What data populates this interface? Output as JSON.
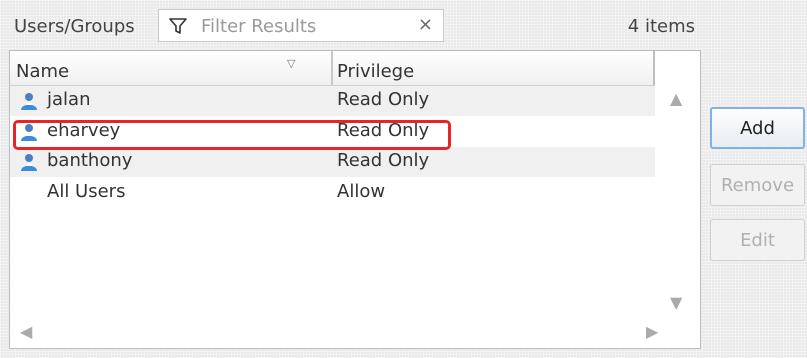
{
  "panel": {
    "title": "Users/Groups",
    "filter_placeholder": "Filter Results",
    "clear_label": "×",
    "item_count": "4 items"
  },
  "table": {
    "columns": [
      "Name",
      "Privilege"
    ],
    "sort_indicator": "▽",
    "rows": [
      {
        "name": "jalan",
        "privilege": "Read Only",
        "icon": "user-icon"
      },
      {
        "name": "eharvey",
        "privilege": "Read Only",
        "icon": "user-icon"
      },
      {
        "name": "banthony",
        "privilege": "Read Only",
        "icon": "user-icon"
      },
      {
        "name": "All Users",
        "privilege": "Allow",
        "icon": ""
      }
    ]
  },
  "scroll": {
    "up": "▲",
    "down": "▼",
    "left": "◀",
    "right": "▶"
  },
  "buttons": {
    "add": "Add",
    "remove": "Remove",
    "edit": "Edit"
  },
  "colors": {
    "highlight": "#e8232a",
    "primary_border": "#7fb2e6"
  }
}
